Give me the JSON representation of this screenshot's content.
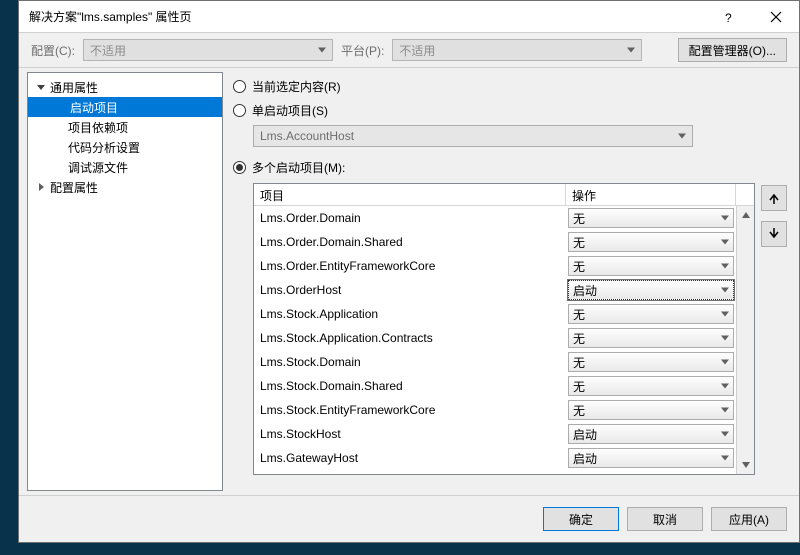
{
  "window": {
    "title": "解决方案\"lms.samples\" 属性页"
  },
  "toolbar": {
    "config_label": "配置(C):",
    "config_value": "不适用",
    "platform_label": "平台(P):",
    "platform_value": "不适用",
    "config_manager": "配置管理器(O)..."
  },
  "tree": {
    "common": "通用属性",
    "startup": "启动项目",
    "deps": "项目依赖项",
    "analysis": "代码分析设置",
    "sources": "调试源文件",
    "cfgprops": "配置属性"
  },
  "radios": {
    "current": "当前选定内容(R)",
    "single": "单启动项目(S)",
    "single_combo": "Lms.AccountHost",
    "multi": "多个启动项目(M):"
  },
  "grid": {
    "col_project": "项目",
    "col_action": "操作",
    "rows": [
      {
        "project": "Lms.Order.Domain",
        "action": "无",
        "selected": false
      },
      {
        "project": "Lms.Order.Domain.Shared",
        "action": "无",
        "selected": false
      },
      {
        "project": "Lms.Order.EntityFrameworkCore",
        "action": "无",
        "selected": false
      },
      {
        "project": "Lms.OrderHost",
        "action": "启动",
        "selected": true
      },
      {
        "project": "Lms.Stock.Application",
        "action": "无",
        "selected": false
      },
      {
        "project": "Lms.Stock.Application.Contracts",
        "action": "无",
        "selected": false
      },
      {
        "project": "Lms.Stock.Domain",
        "action": "无",
        "selected": false
      },
      {
        "project": "Lms.Stock.Domain.Shared",
        "action": "无",
        "selected": false
      },
      {
        "project": "Lms.Stock.EntityFrameworkCore",
        "action": "无",
        "selected": false
      },
      {
        "project": "Lms.StockHost",
        "action": "启动",
        "selected": false
      },
      {
        "project": "Lms.GatewayHost",
        "action": "启动",
        "selected": false
      }
    ]
  },
  "buttons": {
    "ok": "确定",
    "cancel": "取消",
    "apply": "应用(A)"
  }
}
